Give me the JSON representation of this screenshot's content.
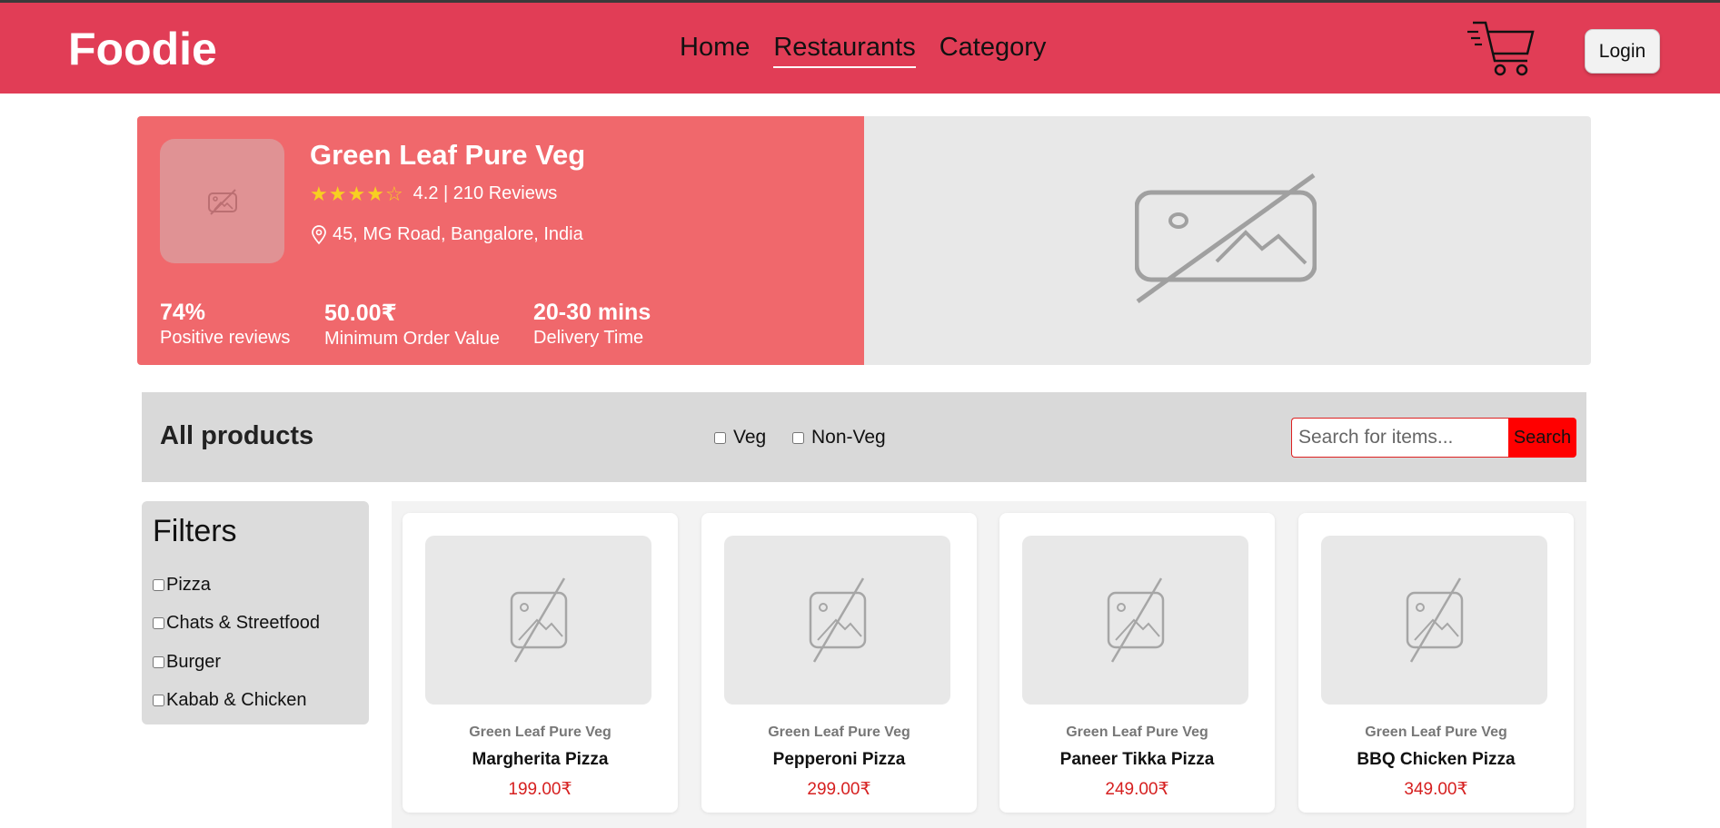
{
  "header": {
    "brand": "Foodie",
    "nav": [
      {
        "label": "Home",
        "active": false
      },
      {
        "label": "Restaurants",
        "active": true
      },
      {
        "label": "Category",
        "active": false
      }
    ],
    "cart_icon": "cart-icon",
    "login_label": "Login",
    "accent_color": "#e13d56"
  },
  "restaurant": {
    "name": "Green Leaf Pure Veg",
    "rating_value": 4.2,
    "rating_text": "4.2 | 210 Reviews",
    "address": "45, MG Road, Bangalore, India",
    "stats": [
      {
        "value": "74%",
        "label": "Positive reviews"
      },
      {
        "value": "50.00₹",
        "label": "Minimum Order Value"
      },
      {
        "value": "20-30 mins",
        "label": "Delivery Time"
      }
    ]
  },
  "products_bar": {
    "title": "All products",
    "type_filters": [
      "Veg",
      "Non-Veg"
    ],
    "search_placeholder": "Search for items...",
    "search_button": "Search"
  },
  "filters": {
    "title": "Filters",
    "categories": [
      "Pizza",
      "Chats & Streetfood",
      "Burger",
      "Kabab & Chicken"
    ]
  },
  "products": [
    {
      "restaurant": "Green Leaf Pure Veg",
      "name": "Margherita Pizza",
      "price": "199.00₹"
    },
    {
      "restaurant": "Green Leaf Pure Veg",
      "name": "Pepperoni Pizza",
      "price": "299.00₹"
    },
    {
      "restaurant": "Green Leaf Pure Veg",
      "name": "Paneer Tikka Pizza",
      "price": "249.00₹"
    },
    {
      "restaurant": "Green Leaf Pure Veg",
      "name": "BBQ Chicken Pizza",
      "price": "349.00₹"
    }
  ]
}
